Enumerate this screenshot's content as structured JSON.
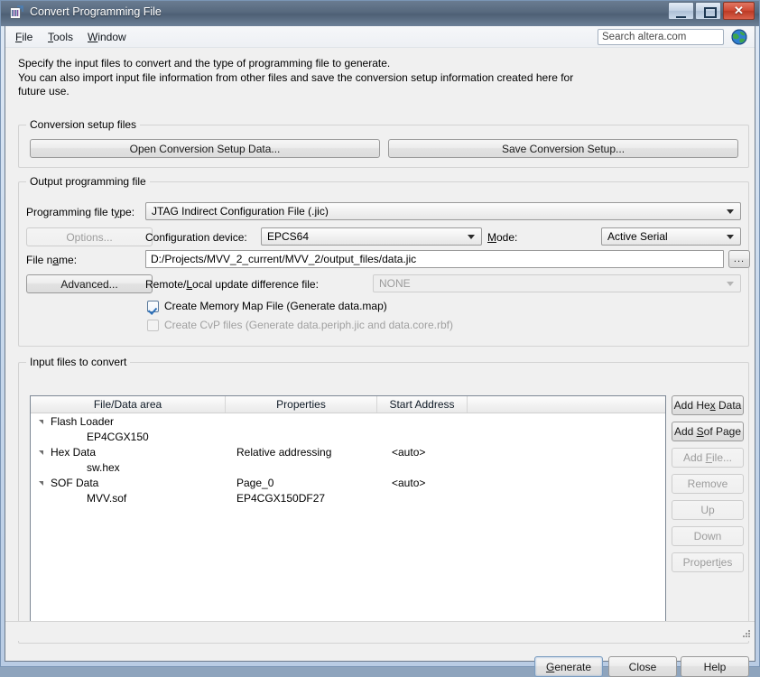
{
  "window": {
    "title": "Convert Programming File",
    "icon": "programming-file-icon",
    "minimize_label": "–",
    "maximize_label": "□",
    "close_label": "✕"
  },
  "menubar": {
    "items": [
      {
        "label": "File",
        "mnemonic": "F"
      },
      {
        "label": "Tools",
        "mnemonic": "T"
      },
      {
        "label": "Window",
        "mnemonic": "W"
      }
    ],
    "search": {
      "placeholder": "Search altera.com",
      "value": "",
      "icon": "globe-icon"
    }
  },
  "intro": {
    "line1": "Specify the input files to convert and the type of programming file to generate.",
    "line2": "You can also import input file information from other files and save the conversion setup information created here for",
    "line3": "future use."
  },
  "conversion_setup": {
    "group_title": "Conversion setup files",
    "open_button": "Open Conversion Setup Data...",
    "save_button": "Save Conversion Setup..."
  },
  "output_file": {
    "group_title": "Output programming file",
    "file_type_label": "Programming file type:",
    "file_type_value": "JTAG Indirect Configuration File (.jic)",
    "options_button": "Options...",
    "config_device_label": "Configuration device:",
    "config_device_value": "EPCS64",
    "mode_label": "Mode:",
    "mode_value": "Active Serial",
    "file_name_label": "File name:",
    "file_name_value": "D:/Projects/MVV_2_current/MVV_2/output_files/data.jic",
    "browse_button": "...",
    "advanced_button": "Advanced...",
    "remote_update_label": "Remote/Local update difference file:",
    "remote_update_value": "NONE",
    "memory_map_checkbox": "Create Memory Map File (Generate data.map)",
    "memory_map_checked": true,
    "cvp_checkbox": "Create CvP files (Generate data.periph.jic and data.core.rbf)",
    "cvp_checked": false,
    "cvp_enabled": false
  },
  "input_files": {
    "group_title": "Input files to convert",
    "columns": [
      "File/Data area",
      "Properties",
      "Start Address",
      ""
    ],
    "rows": [
      {
        "name": "Flash Loader",
        "properties": "",
        "start_address": "",
        "indent": 0,
        "expander": true
      },
      {
        "name": "EP4CGX150",
        "properties": "",
        "start_address": "",
        "indent": 1,
        "expander": false
      },
      {
        "name": "Hex Data",
        "properties": "Relative addressing",
        "start_address": "<auto>",
        "indent": 0,
        "expander": true
      },
      {
        "name": "sw.hex",
        "properties": "",
        "start_address": "",
        "indent": 1,
        "expander": false
      },
      {
        "name": "SOF Data",
        "properties": "Page_0",
        "start_address": "<auto>",
        "indent": 0,
        "expander": true
      },
      {
        "name": "MVV.sof",
        "properties": "EP4CGX150DF27",
        "start_address": "",
        "indent": 1,
        "expander": false
      }
    ],
    "side_buttons": [
      {
        "label": "Add Hex Data",
        "mnemonic": "x",
        "enabled": true
      },
      {
        "label": "Add Sof Page",
        "mnemonic": "S",
        "enabled": true
      },
      {
        "label": "Add File...",
        "mnemonic": "F",
        "enabled": false
      },
      {
        "label": "Remove",
        "mnemonic": "",
        "enabled": false
      },
      {
        "label": "Up",
        "mnemonic": "",
        "enabled": false
      },
      {
        "label": "Down",
        "mnemonic": "",
        "enabled": false
      },
      {
        "label": "Properties",
        "mnemonic": "i",
        "enabled": false
      }
    ]
  },
  "footer": {
    "generate_button": "Generate",
    "close_button": "Close",
    "help_button": "Help"
  },
  "colors": {
    "titlebar": "#55677c",
    "close_red": "#cf4a35",
    "accent": "#2c6fb8",
    "frame": "#c9d9ec"
  }
}
